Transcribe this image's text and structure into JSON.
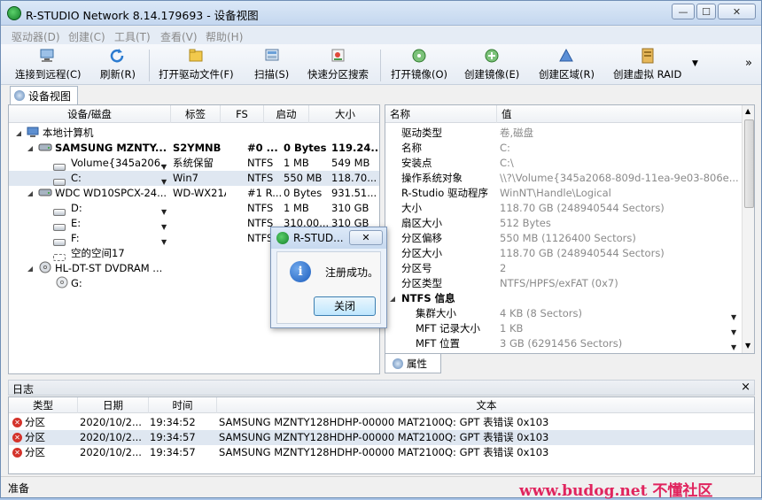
{
  "window": {
    "title": "R-STUDIO Network 8.14.179693 - 设备视图",
    "minimize": "—",
    "maximize": "☐",
    "close": "✕"
  },
  "menu": [
    "驱动器(D)",
    "创建(C)",
    "工具(T)",
    "查看(V)",
    "帮助(H)"
  ],
  "toolbar": {
    "connect": "连接到远程(C)",
    "refresh": "刷新(R)",
    "open_drive_files": "打开驱动文件(F)",
    "scan": "扫描(S)",
    "quick_partition_search": "快速分区搜索",
    "open_image": "打开镜像(O)",
    "create_image": "创建镜像(E)",
    "create_region": "创建区域(R)",
    "create_virtual_raid": "创建虚拟 RAID",
    "more": "»"
  },
  "tab": {
    "label": "设备视图"
  },
  "device_table": {
    "headers": [
      "设备/磁盘",
      "标签",
      "FS",
      "启动",
      "大小"
    ],
    "rows": [
      {
        "name": "本地计算机",
        "label": "",
        "fs": "",
        "start": "",
        "size": ""
      },
      {
        "name": "SAMSUNG MZNTY...",
        "label": "S2YMNB0...",
        "fs": "#0 ...",
        "start": "0 Bytes",
        "size": "119.24..."
      },
      {
        "name": "Volume{345a206...",
        "label": "系统保留",
        "fs": "NTFS",
        "start": "1 MB",
        "size": "549 MB"
      },
      {
        "name": "C:",
        "label": "Win7",
        "fs": "NTFS",
        "start": "550 MB",
        "size": "118.70..."
      },
      {
        "name": "WDC WD10SPCX-24...",
        "label": "WD-WX21A...",
        "fs": "#1 R...",
        "start": "0 Bytes",
        "size": "931.51..."
      },
      {
        "name": "D:",
        "label": "",
        "fs": "NTFS",
        "start": "1 MB",
        "size": "310 GB"
      },
      {
        "name": "E:",
        "label": "",
        "fs": "NTFS",
        "start": "310.00...",
        "size": "310 GB"
      },
      {
        "name": "F:",
        "label": "",
        "fs": "NTFS",
        "start": "",
        "size": ""
      },
      {
        "name": "空的空间17",
        "label": "",
        "fs": "",
        "start": "",
        "size": ""
      },
      {
        "name": "HL-DT-ST DVDRAM ...",
        "label": "",
        "fs": "",
        "start": "",
        "size": ""
      },
      {
        "name": "G:",
        "label": "",
        "fs": "",
        "start": "",
        "size": ""
      }
    ]
  },
  "properties": {
    "headers": [
      "名称",
      "值"
    ],
    "rows": [
      {
        "name": "驱动类型",
        "value": "卷,磁盘"
      },
      {
        "name": "名称",
        "value": "C:"
      },
      {
        "name": "安装点",
        "value": "C:\\"
      },
      {
        "name": "操作系统对象",
        "value": "\\\\?\\Volume{345a2068-809d-11ea-9e03-806e..."
      },
      {
        "name": "R-Studio 驱动程序",
        "value": "WinNT\\Handle\\Logical"
      },
      {
        "name": "大小",
        "value": "118.70 GB (248940544 Sectors)"
      },
      {
        "name": "扇区大小",
        "value": "512 Bytes"
      },
      {
        "name": "分区偏移",
        "value": "550 MB (1126400 Sectors)"
      },
      {
        "name": "分区大小",
        "value": "118.70 GB (248940544 Sectors)"
      },
      {
        "name": "分区号",
        "value": "2"
      },
      {
        "name": "分区类型",
        "value": "NTFS/HPFS/exFAT (0x7)"
      },
      {
        "name": "NTFS 信息",
        "value": ""
      },
      {
        "name": "集群大小",
        "value": "4 KB (8 Sectors)"
      },
      {
        "name": "MFT 记录大小",
        "value": "1 KB"
      },
      {
        "name": "MFT 位置",
        "value": "3 GB (6291456 Sectors)"
      }
    ],
    "tab_label": "属性"
  },
  "dialog": {
    "title": "R-STUD...",
    "message": "注册成功。",
    "close_button": "关闭"
  },
  "log": {
    "title": "日志",
    "close": "×",
    "headers": [
      "类型",
      "日期",
      "时间",
      "文本"
    ],
    "rows": [
      {
        "type": "分区",
        "date": "2020/10/2...",
        "time": "19:34:52",
        "text": "SAMSUNG MZNTY128HDHP-00000 MAT2100Q: GPT 表错误 0x103"
      },
      {
        "type": "分区",
        "date": "2020/10/2...",
        "time": "19:34:57",
        "text": "SAMSUNG MZNTY128HDHP-00000 MAT2100Q: GPT 表错误 0x103"
      },
      {
        "type": "分区",
        "date": "2020/10/2...",
        "time": "19:34:57",
        "text": "SAMSUNG MZNTY128HDHP-00000 MAT2100Q: GPT 表错误 0x103"
      }
    ]
  },
  "status": {
    "text": "准备"
  },
  "watermark": {
    "text": "www.budog.net 不懂社区"
  },
  "colors": {
    "accent": "#dfe7f1",
    "error": "#d4332b",
    "watermark": "#e0245e"
  }
}
